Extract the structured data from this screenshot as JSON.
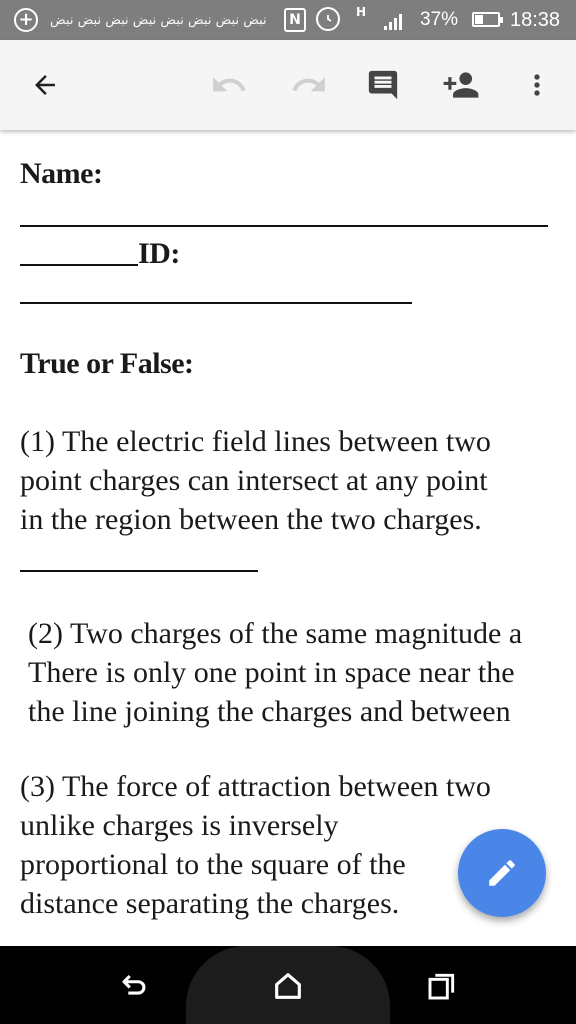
{
  "status_bar": {
    "notification_text": "نبض نبض نبض نبض نبض نبض نبض نبض",
    "nfc_label": "N",
    "network_type": "H",
    "battery_percent": "37%",
    "battery_level": 0.37,
    "time": "18:38",
    "color": "#7e7e7e"
  },
  "toolbar": {
    "icons": [
      "arrow-left-icon",
      "undo-icon",
      "redo-icon",
      "comment-icon",
      "add-person-icon",
      "more-vert-icon"
    ],
    "background": "#f5f5f5"
  },
  "document": {
    "name_label": "Name:",
    "id_label": "ID:",
    "section_heading": "True or False:",
    "q1_lines": [
      "(1) The electric field lines between two",
      "point charges can intersect at any point",
      "in the region between the two charges."
    ],
    "q2_lines": [
      "(2) Two charges of the same magnitude a",
      "There is only one point in space near the",
      "the line joining the charges and between"
    ],
    "q3_lines": [
      "(3) The force of attraction between two",
      "unlike charges is inversely",
      "proportional to the square of the",
      "distance separating the charges."
    ]
  },
  "fab": {
    "icon": "pencil-icon",
    "color": "#4a86e8"
  },
  "nav_bar": {
    "icons": [
      "back-icon",
      "home-icon",
      "recent-apps-icon"
    ]
  }
}
